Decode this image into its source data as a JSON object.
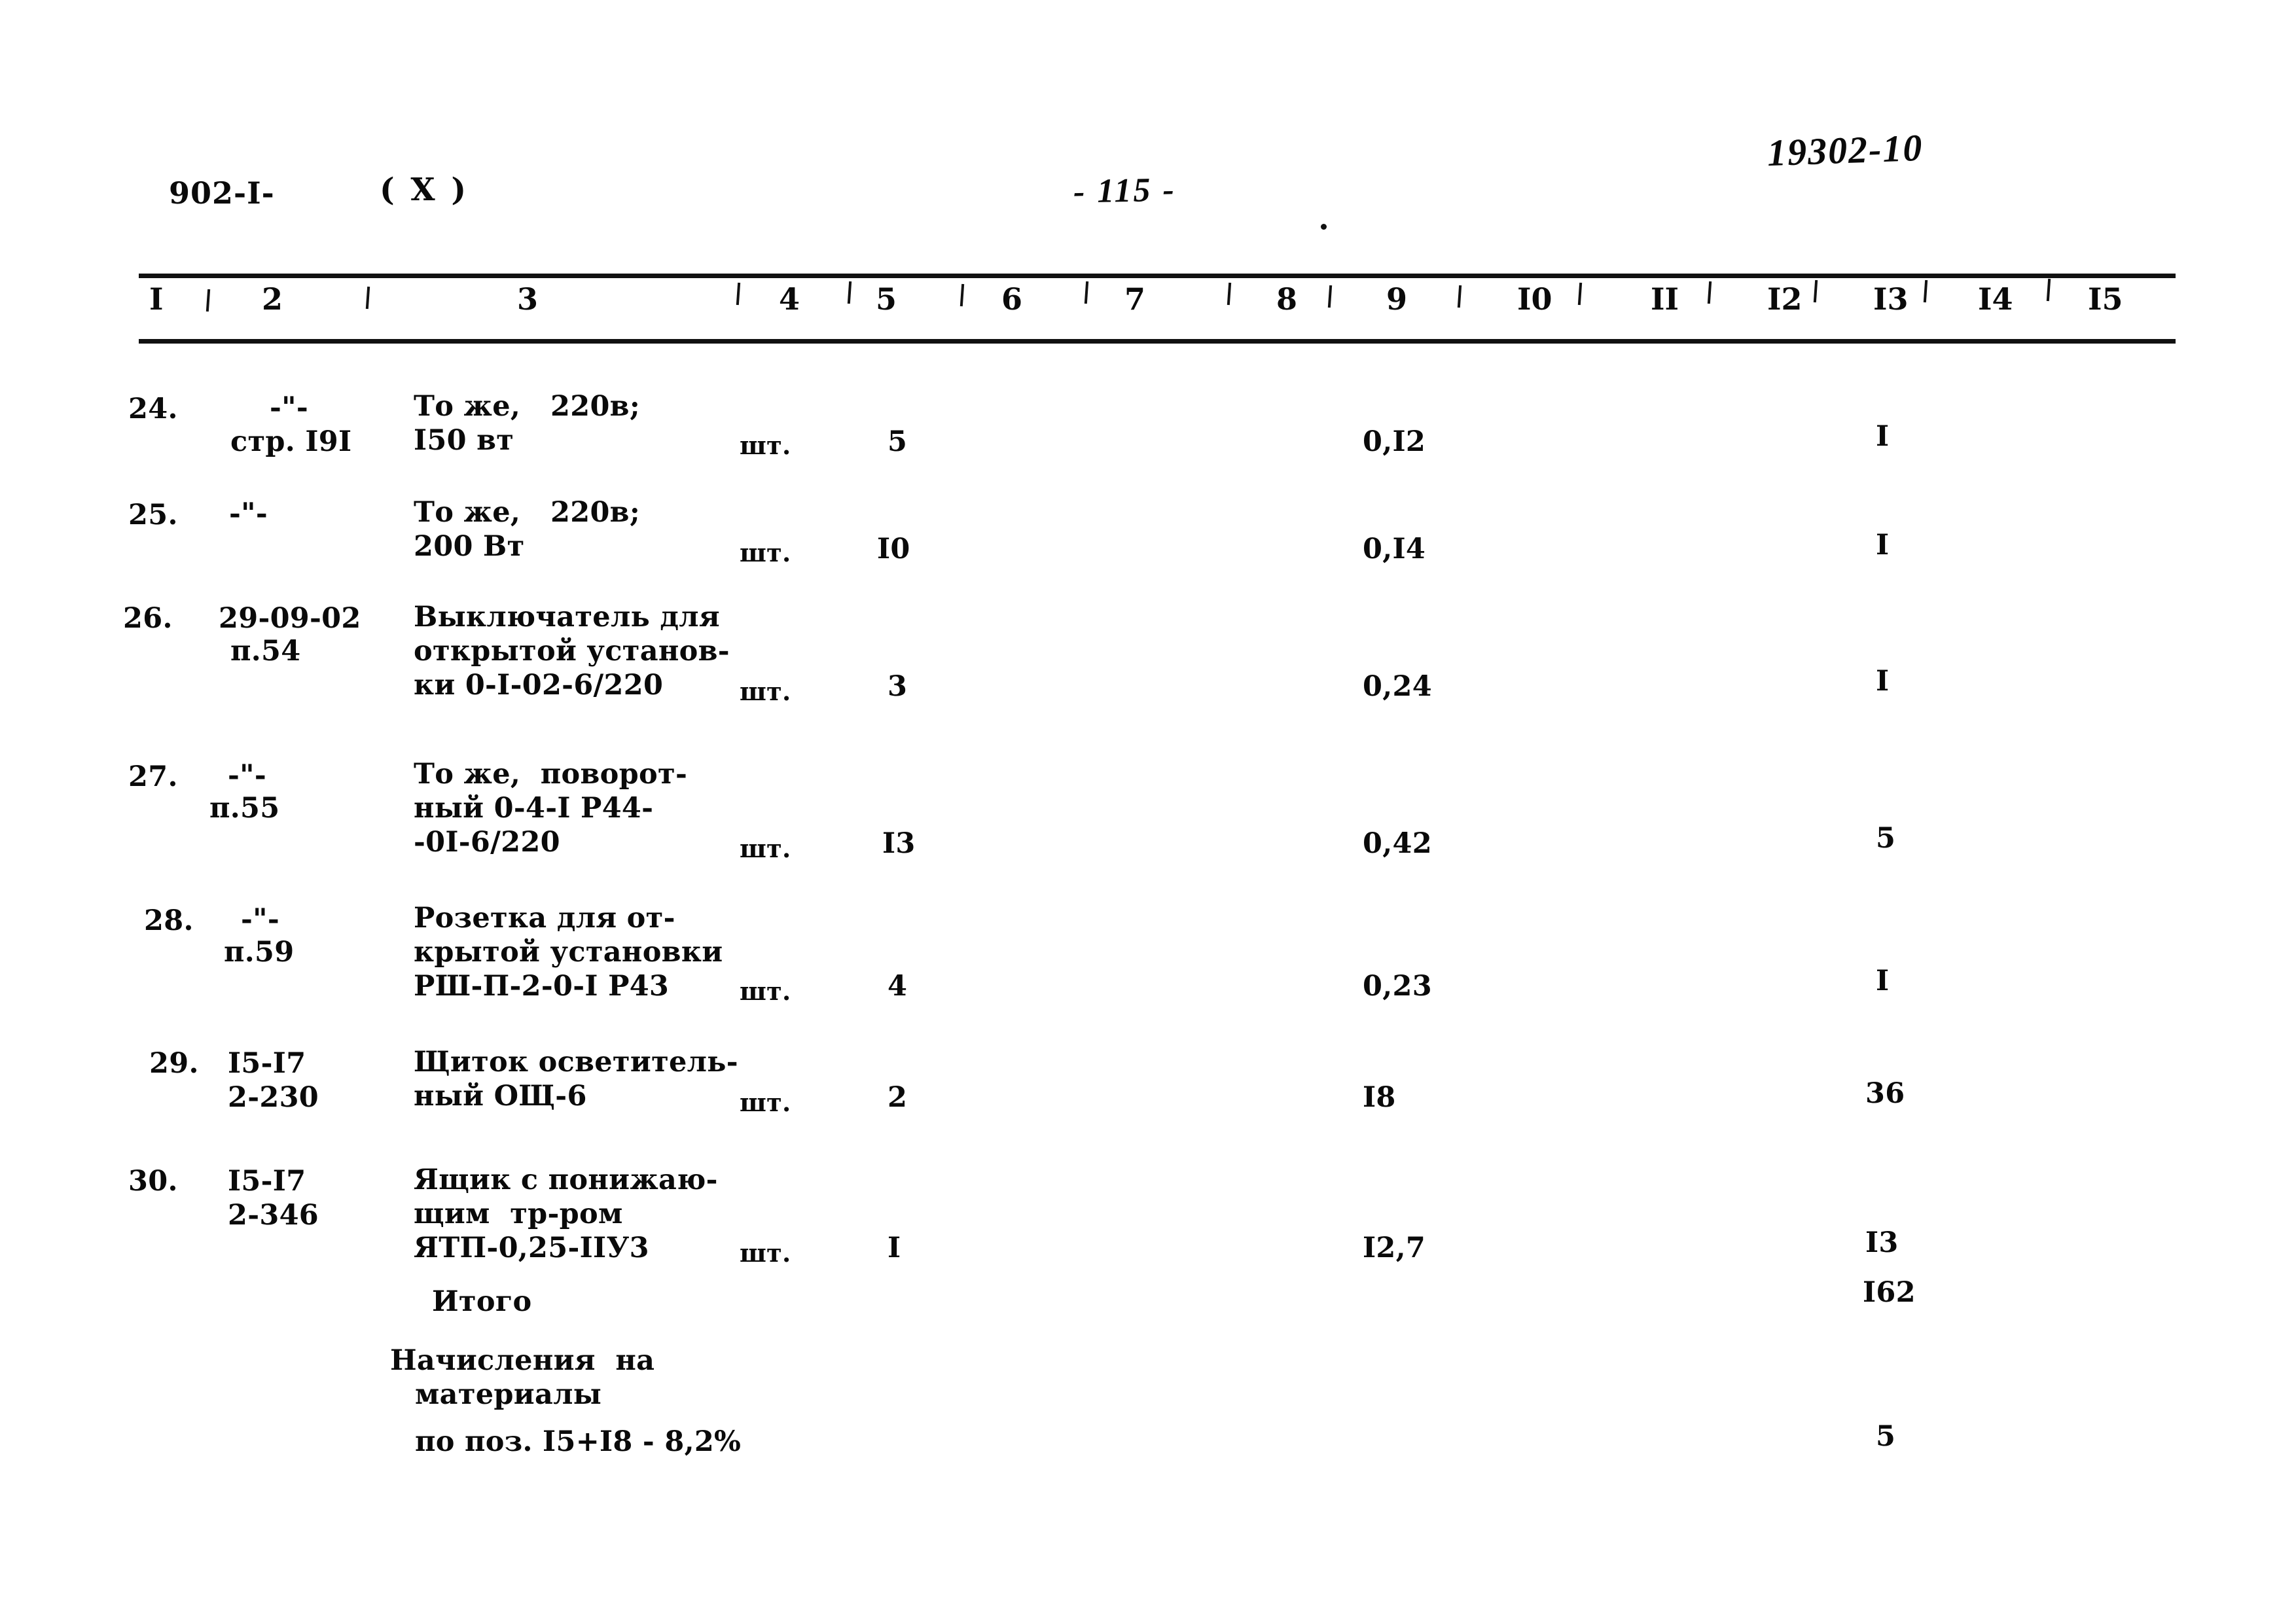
{
  "header": {
    "doc_code": "902-I-",
    "doc_variant": "( X )",
    "page_number": "- 115 -",
    "archive_stamp": "19302-10"
  },
  "table": {
    "column_headers": [
      "I",
      "2",
      "3",
      "4",
      "5",
      "6",
      "7",
      "8",
      "9",
      "I0",
      "II",
      "I2",
      "I3",
      "I4",
      "I5"
    ],
    "rows": [
      {
        "num": "24.",
        "code_line1": "-\"-",
        "code_line2": "стр. I9I",
        "desc_line1": "То же,   220в;",
        "desc_line2": "I50 вт",
        "desc_line3": "",
        "unit": "шт.",
        "qty": "5",
        "col9": "0,I2",
        "col13": "I"
      },
      {
        "num": "25.",
        "code_line1": "-\"-",
        "code_line2": "",
        "desc_line1": "То же,   220в;",
        "desc_line2": "200 Вт",
        "desc_line3": "",
        "unit": "шт.",
        "qty": "I0",
        "col9": "0,I4",
        "col13": "I"
      },
      {
        "num": "26.",
        "code_line1": "29-09-02",
        "code_line2": "п.54",
        "desc_line1": "Выключатель для",
        "desc_line2": "открытой установ-",
        "desc_line3": "ки 0-I-02-6/220",
        "unit": "шт.",
        "qty": "3",
        "col9": "0,24",
        "col13": "I"
      },
      {
        "num": "27.",
        "code_line1": "-\"-",
        "code_line2": "п.55",
        "desc_line1": "То же,  поворот-",
        "desc_line2": "ный 0-4-I Р44-",
        "desc_line3": "-0I-6/220",
        "unit": "шт.",
        "qty": "I3",
        "col9": "0,42",
        "col13": "5"
      },
      {
        "num": "28.",
        "code_line1": "-\"-",
        "code_line2": "п.59",
        "desc_line1": "Розетка для от-",
        "desc_line2": "крытой установки",
        "desc_line3": "РШ-П-2-0-I Р43",
        "unit": "шт.",
        "qty": "4",
        "col9": "0,23",
        "col13": "I"
      },
      {
        "num": "29.",
        "code_line1": "I5-I7",
        "code_line2": "2-230",
        "desc_line1": "Щиток осветитель-",
        "desc_line2": "ный ОЩ-6",
        "desc_line3": "",
        "unit": "шт.",
        "qty": "2",
        "col9": "I8",
        "col13": "36"
      },
      {
        "num": "30.",
        "code_line1": "I5-I7",
        "code_line2": "2-346",
        "desc_line1": "Ящик с понижаю-",
        "desc_line2": "щим  тр-ром",
        "desc_line3": "ЯТП-0,25-IIУ3",
        "unit": "шт.",
        "qty": "I",
        "col9": "I2,7",
        "col13": "I3"
      }
    ],
    "summary": [
      {
        "label_line1": "Итого",
        "label_line2": "",
        "label_line3": "",
        "col13": "I62"
      },
      {
        "label_line1": "Начисления  на",
        "label_line2": "материалы",
        "label_line3": "по поз. I5+I8 - 8,2%",
        "col13": "5"
      }
    ]
  }
}
